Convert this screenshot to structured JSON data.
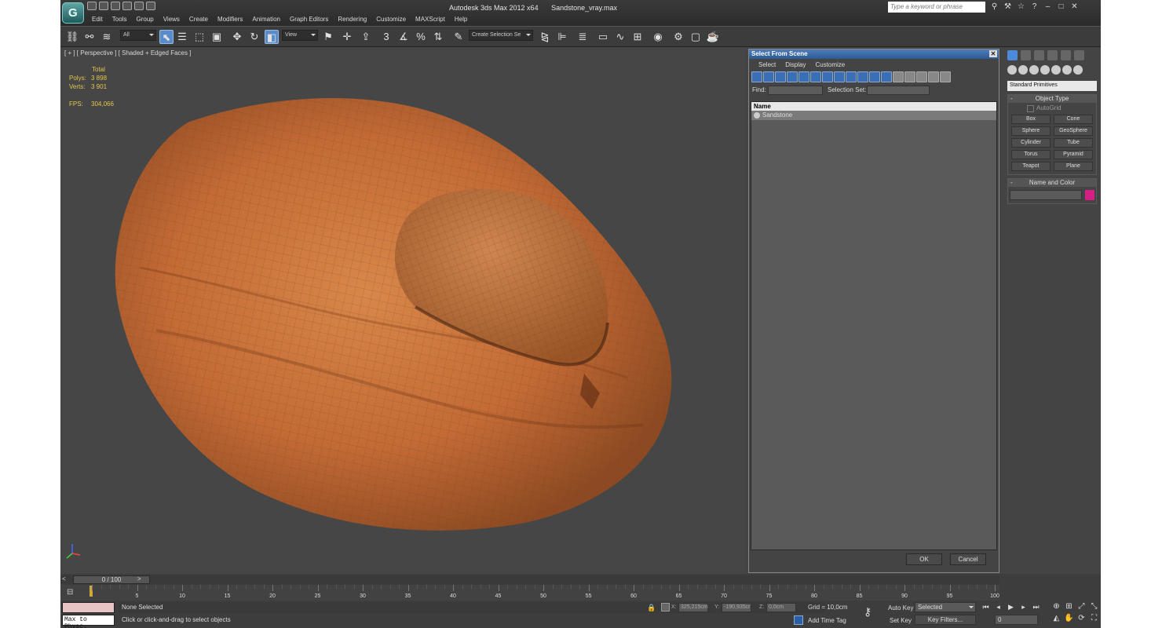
{
  "window": {
    "title_app": "Autodesk 3ds Max  2012 x64",
    "title_file": "Sandstone_vray.max",
    "search_placeholder": "Type a keyword or phrase"
  },
  "menu": [
    "Edit",
    "Tools",
    "Group",
    "Views",
    "Create",
    "Modifiers",
    "Animation",
    "Graph Editors",
    "Rendering",
    "Customize",
    "MAXScript",
    "Help"
  ],
  "toolbar": {
    "filter": "All",
    "refcoord": "View",
    "selset": "Create Selection Se",
    "snap_label": "3"
  },
  "viewport": {
    "label": "[ + ] [ Perspective ] [ Shaded + Edged Faces ]",
    "stats_header": "Total",
    "polys_label": "Polys:",
    "polys_value": "3 898",
    "verts_label": "Verts:",
    "verts_value": "3 901",
    "fps_label": "FPS:",
    "fps_value": "304,066",
    "wire_color": "#7a4a2a",
    "rock_color": "#c8713a"
  },
  "dialog": {
    "title": "Select From Scene",
    "menu": [
      "Select",
      "Display",
      "Customize"
    ],
    "find_label": "Find:",
    "selset_label": "Selection Set:",
    "column": "Name",
    "items": [
      "Sandstone"
    ],
    "ok": "OK",
    "cancel": "Cancel"
  },
  "command_panel": {
    "dropdown": "Standard Primitives",
    "rollout_object_type": "Object Type",
    "autogrid": "AutoGrid",
    "buttons": [
      "Box",
      "Cone",
      "Sphere",
      "GeoSphere",
      "Cylinder",
      "Tube",
      "Torus",
      "Pyramid",
      "Teapot",
      "Plane"
    ],
    "rollout_name_color": "Name and Color",
    "object_color": "#d31f86"
  },
  "timeline": {
    "slider": "0 / 100",
    "ticks": [
      5,
      10,
      15,
      20,
      25,
      30,
      35,
      40,
      45,
      50,
      55,
      60,
      65,
      70,
      75,
      80,
      85,
      90,
      95,
      100
    ],
    "max": 100
  },
  "status": {
    "selection": "None Selected",
    "prompt": "Click or click-and-drag to select objects",
    "maxscript": "Max to Physc.",
    "x_label": "X:",
    "x": "325,215cm",
    "y_label": "Y:",
    "y": "-190,935cr",
    "z_label": "Z:",
    "z": "0,0cm",
    "grid": "Grid = 10,0cm",
    "add_time_tag": "Add Time Tag",
    "auto_key": "Auto Key",
    "set_key": "Set Key",
    "key_mode": "Selected",
    "key_filters": "Key Filters...",
    "frame": "0"
  }
}
